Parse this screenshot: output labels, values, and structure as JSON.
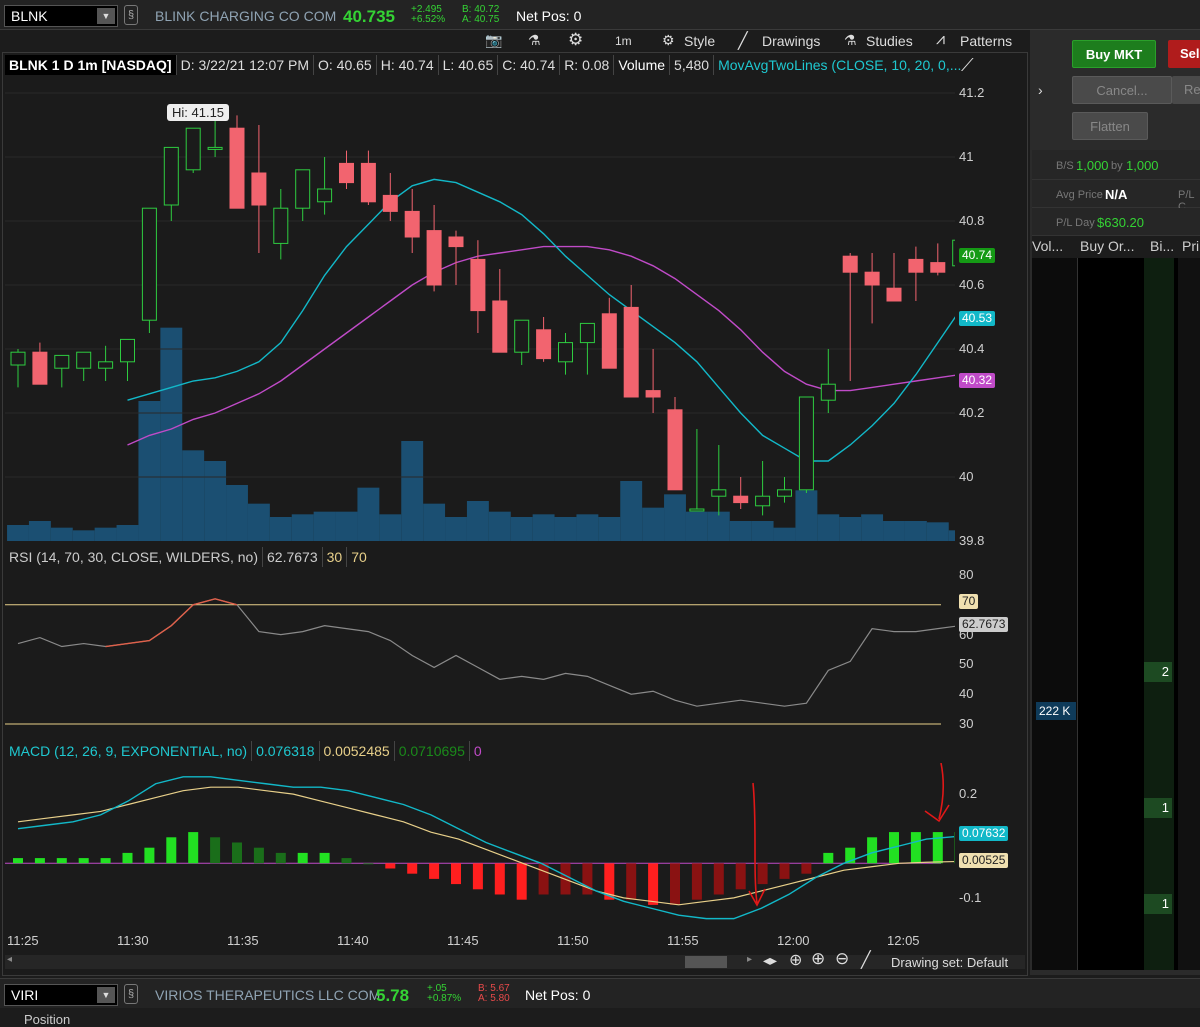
{
  "top": {
    "symbol": "BLNK",
    "company": "BLINK CHARGING CO COM",
    "last": "40.735",
    "change": "+2.495",
    "change_pct": "+6.52%",
    "bid": "B: 40.72",
    "ask": "A: 40.75",
    "net_pos": "Net Pos: 0"
  },
  "toolbar": {
    "interval": "1m",
    "style": "Style",
    "drawings": "Drawings",
    "studies": "Studies",
    "patterns": "Patterns"
  },
  "chart": {
    "info": {
      "title": "BLNK 1 D 1m [NASDAQ]",
      "date": "D: 3/22/21 12:07 PM",
      "open": "O: 40.65",
      "high": "H: 40.74",
      "low": "L: 40.65",
      "close": "C: 40.74",
      "range": "R: 0.08",
      "volume_label": "Volume",
      "volume": "5,480",
      "study": "MovAvgTwoLines (CLOSE, 10, 20, 0,..."
    },
    "hi_label": "Hi: 41.15",
    "price_ticks": [
      "41.2",
      "41",
      "40.8",
      "40.6",
      "40.4",
      "40.2",
      "40",
      "39.8"
    ],
    "tags": {
      "last": "40.74",
      "ma_fast": "40.53",
      "ma_slow": "40.32"
    },
    "rsi": {
      "label": "RSI (14, 70, 30, CLOSE, WILDERS, no)",
      "value": "62.7673",
      "ob": "30",
      "os": "70",
      "ticks": [
        "80",
        "70",
        "60",
        "50",
        "40",
        "30"
      ],
      "tag70": "70",
      "tagval": "62.7673"
    },
    "macd": {
      "label": "MACD (12, 26, 9, EXPONENTIAL, no)",
      "v1": "0.076318",
      "v2": "0.0052485",
      "v3": "0.0710695",
      "v4": "0",
      "ticks": [
        "0.2",
        "-0.1"
      ],
      "tag1": "0.07632",
      "tag2": "0.00525"
    },
    "x_ticks": [
      "11:25",
      "11:30",
      "11:35",
      "11:40",
      "11:45",
      "11:50",
      "11:55",
      "12:00",
      "12:05"
    ],
    "drawing_set": "Drawing set: Default"
  },
  "chart_data": {
    "type": "candlestick",
    "title": "BLNK 1 D 1m [NASDAQ]",
    "ylim": [
      39.8,
      41.25
    ],
    "x": [
      "11:24",
      "11:25",
      "11:26",
      "11:27",
      "11:28",
      "11:29",
      "11:30",
      "11:31",
      "11:32",
      "11:33",
      "11:34",
      "11:35",
      "11:36",
      "11:37",
      "11:38",
      "11:39",
      "11:40",
      "11:41",
      "11:42",
      "11:43",
      "11:44",
      "11:45",
      "11:46",
      "11:47",
      "11:48",
      "11:49",
      "11:50",
      "11:51",
      "11:52",
      "11:53",
      "11:54",
      "11:55",
      "11:56",
      "11:57",
      "11:58",
      "11:59",
      "12:00",
      "12:01",
      "12:02",
      "12:03",
      "12:04",
      "12:05",
      "12:06",
      "12:07"
    ],
    "open": [
      40.35,
      40.39,
      40.34,
      40.34,
      40.34,
      40.36,
      40.49,
      40.85,
      40.96,
      41.03,
      41.09,
      40.95,
      40.73,
      40.84,
      40.86,
      40.98,
      40.98,
      40.88,
      40.83,
      40.77,
      40.75,
      40.68,
      40.55,
      40.39,
      40.46,
      40.36,
      40.42,
      40.51,
      40.53,
      40.27,
      40.21,
      39.9,
      39.94,
      39.94,
      39.91,
      39.94,
      39.96,
      40.24,
      40.69,
      40.64,
      40.59,
      40.68,
      40.67,
      40.66
    ],
    "high": [
      40.4,
      40.42,
      40.38,
      40.39,
      40.41,
      40.43,
      40.6,
      41.0,
      41.09,
      41.15,
      41.13,
      41.1,
      40.9,
      40.95,
      41.0,
      41.02,
      41.02,
      40.95,
      40.9,
      40.85,
      40.77,
      40.74,
      40.65,
      40.47,
      40.5,
      40.45,
      40.47,
      40.56,
      40.6,
      40.4,
      40.25,
      40.15,
      40.1,
      40.0,
      40.05,
      40.0,
      40.25,
      40.4,
      40.7,
      40.7,
      40.7,
      40.72,
      40.73,
      40.75
    ],
    "low": [
      40.28,
      40.33,
      40.28,
      40.3,
      40.3,
      40.3,
      40.45,
      40.8,
      40.95,
      41.0,
      40.9,
      40.7,
      40.68,
      40.8,
      40.82,
      40.9,
      40.85,
      40.8,
      40.7,
      40.58,
      40.6,
      40.45,
      40.42,
      40.35,
      40.36,
      40.32,
      40.32,
      40.35,
      40.4,
      40.2,
      40.1,
      39.9,
      39.88,
      39.9,
      39.88,
      39.92,
      39.95,
      40.2,
      40.3,
      40.48,
      40.55,
      40.55,
      40.63,
      40.63
    ],
    "close": [
      40.39,
      40.29,
      40.38,
      40.39,
      40.36,
      40.43,
      40.84,
      41.03,
      41.09,
      41.03,
      40.84,
      40.85,
      40.84,
      40.96,
      40.9,
      40.92,
      40.86,
      40.83,
      40.75,
      40.6,
      40.72,
      40.52,
      40.39,
      40.49,
      40.37,
      40.42,
      40.48,
      40.34,
      40.25,
      40.25,
      39.96,
      39.9,
      39.96,
      39.92,
      39.94,
      39.96,
      40.25,
      40.29,
      40.64,
      40.6,
      40.55,
      40.64,
      40.64,
      40.74
    ],
    "volume": [
      12,
      15,
      10,
      8,
      10,
      12,
      105,
      160,
      68,
      60,
      42,
      28,
      18,
      20,
      22,
      22,
      40,
      20,
      75,
      28,
      18,
      30,
      22,
      18,
      20,
      18,
      20,
      18,
      45,
      25,
      35,
      22,
      22,
      15,
      15,
      10,
      38,
      20,
      18,
      20,
      15,
      15,
      14,
      8
    ],
    "ma_fast": [
      40.24,
      40.26,
      40.28,
      40.3,
      40.31,
      40.33,
      40.36,
      40.42,
      40.52,
      40.63,
      40.72,
      40.79,
      40.86,
      40.91,
      40.93,
      40.92,
      40.89,
      40.86,
      40.82,
      40.76,
      40.69,
      40.63,
      40.57,
      40.52,
      40.47,
      40.42,
      40.36,
      40.28,
      40.2,
      40.13,
      40.09,
      40.05,
      40.05,
      40.1,
      40.16,
      40.23,
      40.32,
      40.42,
      40.52
    ],
    "ma_slow": [
      40.1,
      40.13,
      40.15,
      40.18,
      40.2,
      40.23,
      40.26,
      40.3,
      40.35,
      40.4,
      40.45,
      40.5,
      40.55,
      40.6,
      40.64,
      40.67,
      40.69,
      40.7,
      40.71,
      40.72,
      40.72,
      40.72,
      40.71,
      40.69,
      40.66,
      40.62,
      40.57,
      40.52,
      40.46,
      40.39,
      40.33,
      40.29,
      40.27,
      40.27,
      40.28,
      40.29,
      40.3,
      40.31,
      40.32
    ],
    "rsi": [
      57,
      59,
      56,
      57,
      56,
      57,
      58,
      63,
      70,
      72,
      70,
      61,
      60,
      61,
      63,
      62,
      61,
      58,
      53,
      49,
      53,
      49,
      45,
      46,
      45,
      47,
      46,
      43,
      40,
      41,
      38,
      36,
      37,
      38,
      37,
      36,
      37,
      48,
      51,
      62,
      61,
      61,
      62,
      63
    ],
    "macd_hist": [
      0.01,
      0.01,
      0.01,
      0.01,
      0.01,
      0.02,
      0.03,
      0.05,
      0.06,
      0.05,
      0.04,
      0.03,
      0.02,
      0.02,
      0.02,
      0.01,
      0.0,
      -0.01,
      -0.02,
      -0.03,
      -0.04,
      -0.05,
      -0.06,
      -0.07,
      -0.06,
      -0.06,
      -0.06,
      -0.07,
      -0.07,
      -0.08,
      -0.08,
      -0.07,
      -0.06,
      -0.05,
      -0.04,
      -0.03,
      -0.02,
      0.02,
      0.03,
      0.05,
      0.06,
      0.06,
      0.06,
      0.06
    ],
    "macd_line": [
      0.1,
      0.11,
      0.12,
      0.14,
      0.18,
      0.23,
      0.25,
      0.25,
      0.24,
      0.23,
      0.22,
      0.22,
      0.21,
      0.19,
      0.17,
      0.14,
      0.1,
      0.06,
      0.03,
      0.0,
      -0.04,
      -0.08,
      -0.11,
      -0.13,
      -0.15,
      -0.16,
      -0.16,
      -0.13,
      -0.09,
      -0.04,
      0.0,
      0.03,
      0.05,
      0.07,
      0.077
    ],
    "macd_signal": [
      0.12,
      0.13,
      0.14,
      0.15,
      0.17,
      0.19,
      0.21,
      0.22,
      0.22,
      0.21,
      0.2,
      0.18,
      0.16,
      0.14,
      0.12,
      0.09,
      0.07,
      0.04,
      0.01,
      -0.02,
      -0.05,
      -0.08,
      -0.1,
      -0.11,
      -0.12,
      -0.11,
      -0.1,
      -0.08,
      -0.06,
      -0.04,
      -0.02,
      -0.01,
      0.0,
      0.003,
      0.005
    ]
  },
  "right": {
    "buy": "Buy MKT",
    "sell": "Sell",
    "cancel": "Cancel...",
    "re": "Re",
    "flatten": "Flatten",
    "bs_label": "B/S",
    "bs_value": "1,000",
    "bs_by": "by",
    "bs_value2": "1,000",
    "avg_label": "Avg Price",
    "avg_value": "N/A",
    "pl_c": "P/L C",
    "pl_label": "P/L Day",
    "pl_value": "$630.20",
    "cols": [
      "Vol...",
      "Buy Or...",
      "Bi...",
      "Pri"
    ],
    "vol_222k": "222 K",
    "bid_vals": [
      "2",
      "1",
      "1"
    ]
  },
  "bottom": {
    "symbol": "VIRI",
    "company": "VIRIOS THERAPEUTICS LLC COM",
    "last": "5.78",
    "change": "+.05",
    "change_pct": "+0.87%",
    "bid": "B: 5.67",
    "ask": "A: 5.80",
    "net_pos": "Net Pos: 0",
    "position": "Position"
  }
}
